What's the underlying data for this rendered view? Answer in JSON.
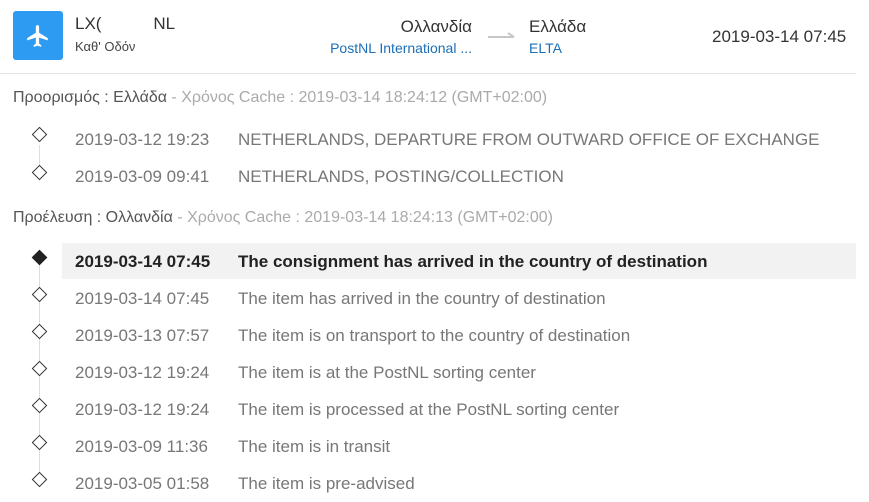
{
  "header": {
    "icon": "airplane-icon",
    "accent_color": "#2e9bf2",
    "tracking_number": "LX(           NL",
    "status": "Καθ' Οδόν",
    "origin_country": "Ολλανδία",
    "origin_carrier": "PostNL International ...",
    "destination_country": "Ελλάδα",
    "destination_carrier": "ELTA",
    "last_update": "2019-03-14 07:45"
  },
  "destination_section": {
    "label": "Προορισμός : Ελλάδα",
    "cache": " - Χρόνος Cache : 2019-03-14 18:24:12 (GMT+02:00)",
    "events": [
      {
        "date": "2019-03-12 19:23",
        "desc": "NETHERLANDS, DEPARTURE FROM OUTWARD OFFICE OF EXCHANGE"
      },
      {
        "date": "2019-03-09 09:41",
        "desc": "NETHERLANDS, POSTING/COLLECTION"
      }
    ]
  },
  "origin_section": {
    "label": "Προέλευση : Ολλανδία",
    "cache": " - Χρόνος Cache : 2019-03-14 18:24:13 (GMT+02:00)",
    "events": [
      {
        "date": "2019-03-14 07:45",
        "desc": "The consignment has arrived in the country of destination",
        "latest": true
      },
      {
        "date": "2019-03-14 07:45",
        "desc": "The item has arrived in the country of destination"
      },
      {
        "date": "2019-03-13 07:57",
        "desc": "The item is on transport to the country of destination"
      },
      {
        "date": "2019-03-12 19:24",
        "desc": "The item is at the PostNL sorting center"
      },
      {
        "date": "2019-03-12 19:24",
        "desc": "The item is processed at the PostNL sorting center"
      },
      {
        "date": "2019-03-09 11:36",
        "desc": "The item is in transit"
      },
      {
        "date": "2019-03-05 01:58",
        "desc": "The item is pre-advised"
      }
    ]
  }
}
